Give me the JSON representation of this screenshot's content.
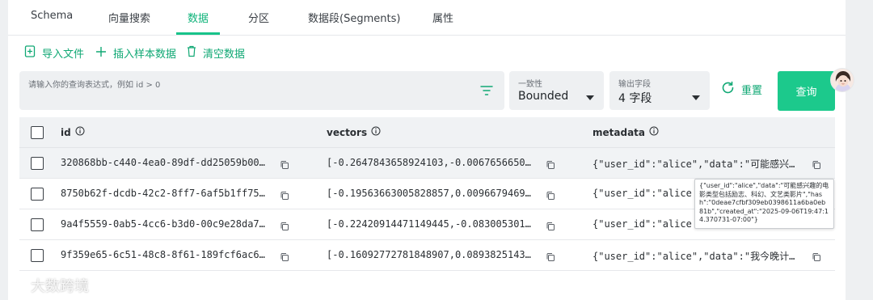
{
  "tabs": [
    {
      "label": "Schema",
      "active": false
    },
    {
      "label": "向量搜索",
      "active": false
    },
    {
      "label": "数据",
      "active": true
    },
    {
      "label": "分区",
      "active": false
    },
    {
      "label": "数据段(Segments)",
      "active": false
    },
    {
      "label": "属性",
      "active": false
    }
  ],
  "actions": {
    "import": "导入文件",
    "insert_sample": "插入样本数据",
    "clear": "清空数据"
  },
  "query": {
    "placeholder": "请输入你的查询表达式，例如 id > 0",
    "consistency_label": "一致性",
    "consistency_value": "Bounded",
    "output_label": "输出字段",
    "output_value": "4 字段",
    "reset": "重置",
    "submit": "查询"
  },
  "table": {
    "columns": [
      "id",
      "vectors",
      "metadata"
    ],
    "rows": [
      {
        "id": "320868bb-c440-4ea0-89df-dd25059b00…",
        "vectors": "[-0.2647843658924103,-0.0067656650…",
        "metadata": "{\"user_id\":\"alice\",\"data\":\"可能感兴…"
      },
      {
        "id": "8750b62f-dcdb-42c2-8ff7-6af5b1ff75…",
        "vectors": "[-0.19563663005828857,0.0096679469…",
        "metadata": "{\"user_id\":\"alice"
      },
      {
        "id": "9a4f5559-0ab5-4cc6-b3d0-00c9e28da7…",
        "vectors": "[-0.22420914471149445,-0.083005301…",
        "metadata": "{\"user_id\":\"alice"
      },
      {
        "id": "9f359e65-6c51-48c8-8f61-189fcf6ac6…",
        "vectors": "[-0.16092772781848907,0.0893825143…",
        "metadata": "{\"user_id\":\"alice\",\"data\":\"我今晚计…"
      }
    ]
  },
  "tooltip": "{\"user_id\":\"alice\",\"data\":\"可能感兴趣的电影类型包括励志、科幻、文艺类影片\",\"hash\":\"0deae7cfbf309eb0398611a6ba0eb81b\",\"created_at\":\"2025-09-06T19:47:14.370731-07:00\"}",
  "watermark": "大数跨境",
  "colors": {
    "accent": "#1cc98c",
    "accent_text": "#10a874"
  }
}
